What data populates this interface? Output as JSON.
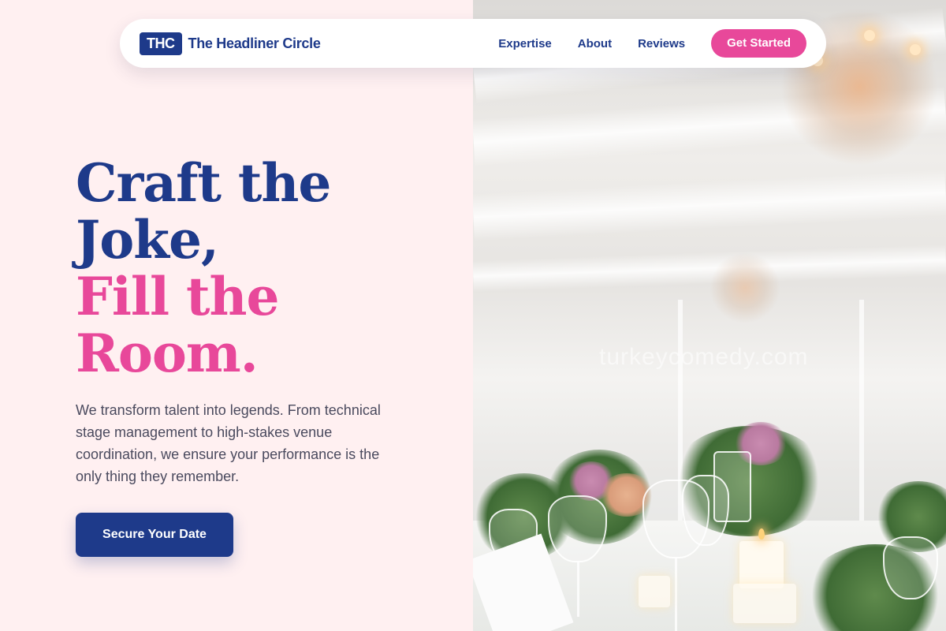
{
  "nav": {
    "logo_badge": "THC",
    "brand_name": "The Headliner Circle",
    "links": [
      "Expertise",
      "About",
      "Reviews"
    ],
    "cta_label": "Get Started"
  },
  "hero": {
    "headline_line1": "Craft the",
    "headline_line2": "Joke,",
    "headline_line3": "Fill the",
    "headline_line4": "Room.",
    "description": "We transform talent into legends. From technical stage management to high-stakes venue coordination, we ensure your performance is the only thing they remember.",
    "button_label": "Secure Your Date"
  },
  "image": {
    "watermark": "turkeycomedy.com"
  },
  "colors": {
    "brand_navy": "#1e3a8a",
    "accent_pink": "#e8489a",
    "background_blush": "#fff0f1"
  }
}
